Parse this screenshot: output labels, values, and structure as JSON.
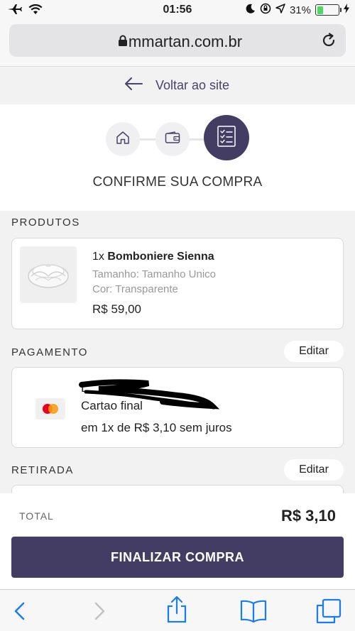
{
  "status_bar": {
    "time": "01:56",
    "battery_percent": "31%",
    "battery_level": 0.31
  },
  "browser": {
    "url": "mmartan.com.br"
  },
  "back_link": {
    "label": "Voltar ao site"
  },
  "checkout": {
    "steps": [
      {
        "icon": "home-icon",
        "state": "done"
      },
      {
        "icon": "wallet-icon",
        "state": "done"
      },
      {
        "icon": "checklist-icon",
        "state": "active"
      }
    ],
    "title": "CONFIRME SUA COMPRA"
  },
  "products": {
    "label": "PRODUTOS",
    "items": [
      {
        "quantity": "1x",
        "name": "Bomboniere Sienna",
        "size": "Tamanho: Tamanho Unico",
        "color": "Cor: Transparente",
        "price": "R$ 59,00"
      }
    ]
  },
  "payment": {
    "label": "PAGAMENTO",
    "edit_label": "Editar",
    "card_holder": "L",
    "card_line": "Cartao final",
    "installments": "em 1x de R$ 3,10 sem juros"
  },
  "pickup": {
    "label": "RETIRADA",
    "edit_label": "Editar"
  },
  "summary": {
    "total_label": "TOTAL",
    "total_value": "R$ 3,10",
    "finalize_label": "FINALIZAR COMPRA"
  },
  "colors": {
    "brand": "#433d63",
    "background": "#f2f2f2",
    "battery": "#4cd964",
    "safari_blue": "#1a7cf5"
  }
}
